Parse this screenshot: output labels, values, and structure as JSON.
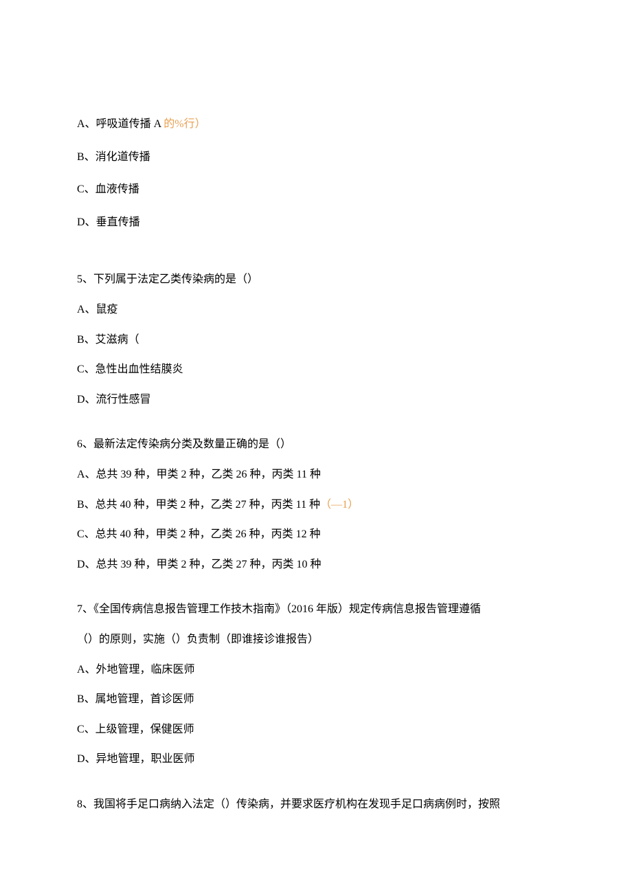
{
  "q4_options": {
    "a_prefix": "A、",
    "a_text": "呼吸道传播 A",
    "a_highlight": " 的%行）",
    "b_prefix": "B、",
    "b_text": "消化道传播",
    "c_prefix": "C、",
    "c_text": "血液传播",
    "d_prefix": "D、",
    "d_text": "垂直传播"
  },
  "q5": {
    "stem": "5、下列属于法定乙类传染病的是（）",
    "a": "A、鼠疫",
    "b": "B、艾滋病（",
    "c": "C、急性出血性结膜炎",
    "d": "D、流行性感冒"
  },
  "q6": {
    "stem": "6、最新法定传染病分类及数量正确的是（）",
    "a": "A、总共 39 种，甲类 2 种，乙类 26 种，丙类 11 种",
    "b": "B、总共 40 种，甲类 2 种，乙类 27 种，丙类 11 种",
    "b_highlight": "（—1）",
    "c": "C、总共 40 种，甲类 2 种，乙类 26 种，丙类 12 种",
    "d": "D、总共 39 种，甲类 2 种，乙类 27 种，丙类 10 种"
  },
  "q7": {
    "stem_line1": "7、《全国传病信息报告管理工作技木指南》（2016 年版）规定传病信息报告管理遵循",
    "stem_line2": "（）的原则，实施（）负责制（即谁接诊谁报告）",
    "a": "A、外地管理，临床医师",
    "b": "B、属地管理，首诊医师",
    "c": "C、上级管理，保健医师",
    "d": "D、异地管理，职业医师"
  },
  "q8": {
    "stem": "8、我国将手足口病纳入法定（）传染病，并要求医疗机构在发现手足口病病例时，按照"
  }
}
